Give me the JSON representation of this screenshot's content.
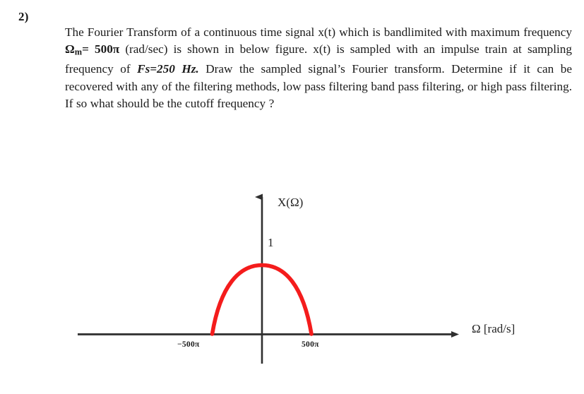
{
  "question": {
    "number": "2)",
    "paragraph": {
      "segment_1": "The Fourier Transform of a continuous time signal x(t) which is bandlimited with maximum frequency ",
      "omega_symbol": "Ω",
      "omega_subscript": "m",
      "omega_value": "= 500π",
      "segment_2": " (rad/sec) is shown in below figure. x(t) is sampled with an impulse train at sampling frequency of ",
      "fs_value": "Fs=250 Hz.",
      "segment_3": " Draw the sampled signal’s Fourier transform. Determine if it can be recovered with any of the filtering methods, low pass filtering band pass filtering, or high pass filtering. If so what should be the cutoff frequency ?"
    }
  },
  "chart_data": {
    "type": "line",
    "title": "",
    "ylabel": "X(Ω)",
    "xlabel": "Ω [rad/s]",
    "y_tick_labels": [
      "1"
    ],
    "x_tick_labels": [
      "−500π",
      "500π"
    ],
    "x_tick_values": [
      -1570.8,
      1570.8
    ],
    "peak_value": 1,
    "curve_color": "#f41c1c",
    "axis_color": "#333333",
    "grid": false,
    "legend": null,
    "xlim": [
      -3700,
      3700
    ],
    "ylim": [
      0,
      1.35
    ],
    "description": "Semicircular/dome-shaped spectrum X(Ω) of amplitude 1 centered at Ω=0, bandlimited between −500π and 500π rad/s",
    "x": [
      -1570.8,
      -1413.7,
      -1256.6,
      -1099.6,
      -942.5,
      -785.4,
      -628.3,
      -471.2,
      -314.2,
      -157.1,
      0,
      157.1,
      314.2,
      471.2,
      628.3,
      785.4,
      942.5,
      1099.6,
      1256.6,
      1413.7,
      1570.8
    ],
    "values": [
      0.0,
      0.436,
      0.6,
      0.714,
      0.8,
      0.866,
      0.917,
      0.954,
      0.98,
      0.995,
      1.0,
      0.995,
      0.98,
      0.954,
      0.917,
      0.866,
      0.8,
      0.714,
      0.6,
      0.436,
      0.0
    ]
  }
}
